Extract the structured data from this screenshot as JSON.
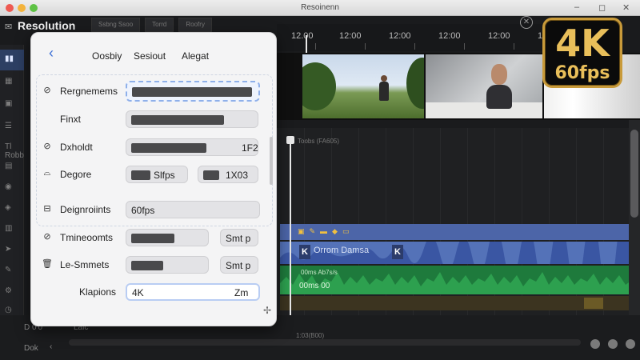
{
  "window": {
    "title": "Resoinenn",
    "controls": [
      "–",
      "◻",
      "✕"
    ]
  },
  "app": {
    "title": "Resolution",
    "tabs": [
      "Ssbng Ssoo",
      "Torrd",
      "Roofry"
    ]
  },
  "rail": {
    "items": [
      "Ss",
      "Tl Robb",
      "Dok",
      "Lalc"
    ]
  },
  "ruler": {
    "labels": [
      "12.00",
      "12:00",
      "12:00",
      "12:00",
      "12:00",
      "12:00",
      "12:05"
    ]
  },
  "timeline": {
    "header": "Toobs (FA605)",
    "blue_clip_label": "Orrom Damsa",
    "green_label": "00ms 00",
    "green_sub": "00ms  Ab7s/s",
    "bottom_time": "1:03(B00)",
    "bottom_left": "D 0'0",
    "bottom_left2": "Dok"
  },
  "badge": {
    "line1": "4K",
    "line2": "60fps"
  },
  "panel": {
    "tabs": [
      "Oosbiy",
      "Sesiout",
      "Alegat"
    ],
    "rows": [
      {
        "label": "Rergnemems",
        "icon": "⊘",
        "value": ""
      },
      {
        "label": "Finxt",
        "icon": "",
        "value": ""
      },
      {
        "label": "Dxholdt",
        "icon": "⊘",
        "value": "1F2"
      },
      {
        "label": "Degore",
        "icon": "⌓",
        "value": "Slfps",
        "value2": "1X03"
      },
      {
        "label": "Deignroiints",
        "icon": "⊟",
        "value": "60fps"
      },
      {
        "label": "Tmineoomts",
        "icon": "⊘",
        "value": "Smt p"
      },
      {
        "label": "Le-Smmets",
        "icon": "🗑",
        "value": "Smt p"
      },
      {
        "label": "Klapions",
        "icon": "",
        "value": "4K",
        "value2": "Zm"
      }
    ]
  }
}
